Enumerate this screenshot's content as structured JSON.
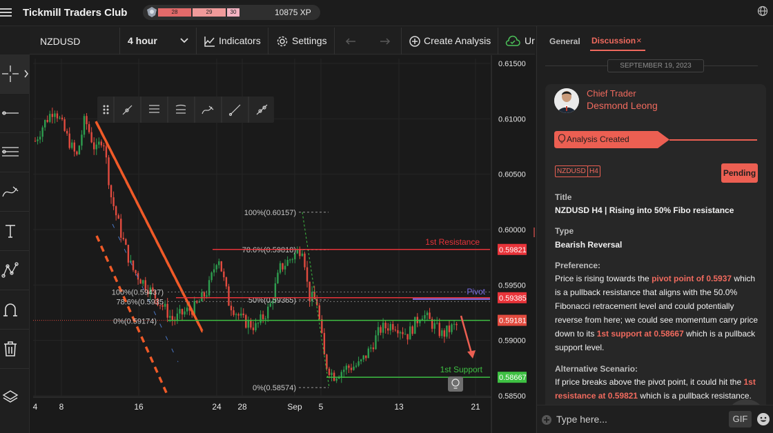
{
  "app": {
    "title": "Tickmill Traders Club",
    "xp": "10875 XP",
    "levels": [
      "28",
      "29",
      "30"
    ]
  },
  "toolbar": {
    "symbol": "NZDUSD",
    "interval": "4 hour",
    "indicators": "Indicators",
    "settings": "Settings",
    "create_analysis": "Create Analysis",
    "upload_cut": "Ur"
  },
  "chart": {
    "price_ticks": [
      "0.61500",
      "0.61000",
      "0.60500",
      "0.60000",
      "0.59500",
      "0.59000",
      "0.58500"
    ],
    "time_ticks": [
      "4",
      "8",
      "16",
      "24",
      "28",
      "Sep",
      "5",
      "13",
      "21"
    ],
    "price_tags": [
      "0.59821",
      "0.59385",
      "0.59181",
      "0.58667"
    ],
    "fib_left": [
      "100%(0.59437)",
      "78.6%(0.5935",
      "0%(0.59174)"
    ],
    "fib_right": [
      "100%(0.60157)",
      "78.6%(0.59818)",
      "50%(0.59365)",
      "0%(0.58574)"
    ],
    "level_labels": {
      "resistance": "1st Resistance",
      "pivot": "Pivot",
      "support": "1st Support"
    },
    "colors": {
      "up": "#2e9e4f",
      "down": "#e24b3f",
      "resistance": "#e8343a",
      "support": "#3ec043",
      "pivot": "#8c6df2",
      "trend": "#f05a28"
    }
  },
  "panel": {
    "tabs": {
      "general": "General",
      "discussion": "Discussion",
      "close": "×"
    },
    "date": "SEPTEMBER 19, 2023",
    "author_role": "Chief Trader",
    "author_name": "Desmond Leong",
    "banner": "Analysis Created",
    "tags": [
      "NZDUSD",
      "H4"
    ],
    "status": "Pending",
    "title_label": "Title",
    "title_value": "NZDUSD H4 | Rising into 50% Fibo resistance",
    "type_label": "Type",
    "type_value": "Bearish Reversal",
    "preference_label": "Preference:",
    "pref_1": "Price is rising towards the ",
    "pref_hl1": "pivot point of 0.5937",
    "pref_2": " which is a pullback resistance that aligns with the 50.0% Fibonacci retracement level and could potentially reverse from here; we could see momentum carry price down to its ",
    "pref_hl2": "1st support at 0.58667",
    "pref_3": " which is a pullback support level.",
    "alt_label": "Alternative Scenario:",
    "alt_1": "If price breaks above the pivot point, it could hit the ",
    "alt_hl1": "1st resistance at 0.59821",
    "alt_2": " which is a pullback resistance.",
    "composer_placeholder": "Type here...",
    "gif": "GIF"
  }
}
